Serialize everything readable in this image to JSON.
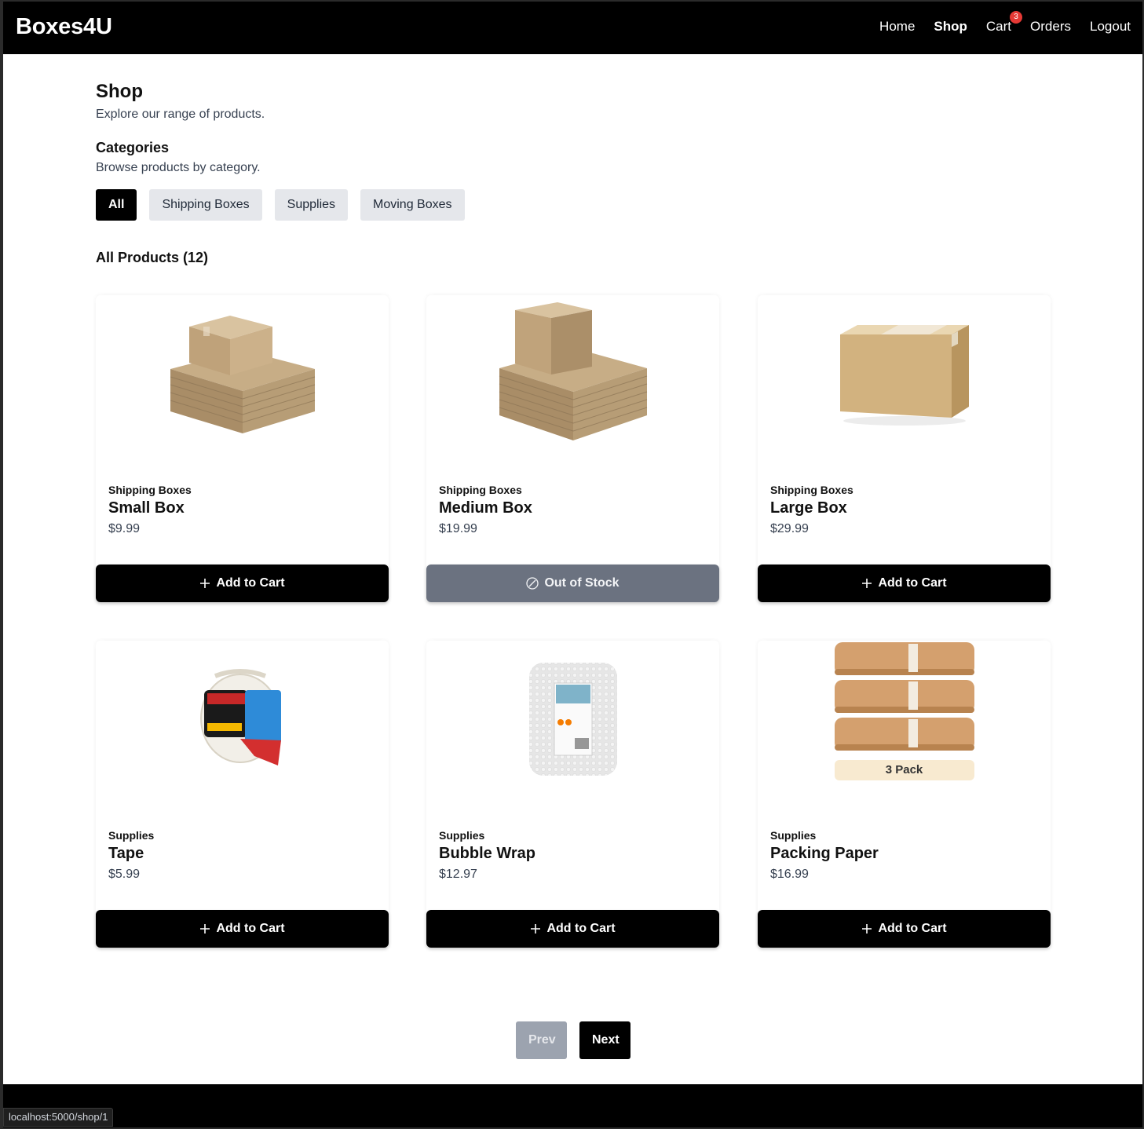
{
  "header": {
    "brand": "Boxes4U",
    "nav": {
      "home": "Home",
      "shop": "Shop",
      "cart": "Cart",
      "cart_count": "3",
      "orders": "Orders",
      "logout": "Logout"
    }
  },
  "shop": {
    "title": "Shop",
    "subtitle": "Explore our range of products."
  },
  "categories": {
    "title": "Categories",
    "subtitle": "Browse products by category.",
    "items": [
      "All",
      "Shipping Boxes",
      "Supplies",
      "Moving Boxes"
    ],
    "selected": "All"
  },
  "products_heading": "All Products (12)",
  "products": [
    {
      "category": "Shipping Boxes",
      "name": "Small Box",
      "price": "$9.99",
      "button": "Add to Cart",
      "in_stock": true,
      "image": "stacked-flat-boxes"
    },
    {
      "category": "Shipping Boxes",
      "name": "Medium Box",
      "price": "$19.99",
      "button": "Out of Stock",
      "in_stock": false,
      "image": "stacked-flat-boxes"
    },
    {
      "category": "Shipping Boxes",
      "name": "Large Box",
      "price": "$29.99",
      "button": "Add to Cart",
      "in_stock": true,
      "image": "single-box"
    },
    {
      "category": "Supplies",
      "name": "Tape",
      "price": "$5.99",
      "button": "Add to Cart",
      "in_stock": true,
      "image": "packaging-tape"
    },
    {
      "category": "Supplies",
      "name": "Bubble Wrap",
      "price": "$12.97",
      "button": "Add to Cart",
      "in_stock": true,
      "image": "bubble-wrap-roll"
    },
    {
      "category": "Supplies",
      "name": "Packing Paper",
      "price": "$16.99",
      "button": "Add to Cart",
      "in_stock": true,
      "image": "kraft-paper-rolls",
      "image_label": "3 Pack"
    }
  ],
  "pagination": {
    "prev": "Prev",
    "next": "Next"
  },
  "status_bar": {
    "url": "localhost:5000/shop/1"
  },
  "colors": {
    "navbar": "#000000",
    "chip_active": "#000000",
    "chip_inactive": "#e5e7eb",
    "out_of_stock": "#6b7280",
    "badge": "#e53935",
    "prev_disabled": "#9ca3af"
  }
}
